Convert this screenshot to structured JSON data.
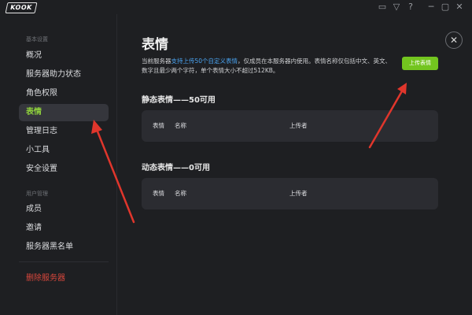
{
  "app": {
    "logo_text": "KOOK"
  },
  "window_controls": [
    "▭",
    "▽",
    "?",
    "─",
    "▢",
    "✕"
  ],
  "sidebar": {
    "section1": "基本设置",
    "items1": [
      "概况",
      "服务器助力状态",
      "角色权限",
      "表情",
      "管理日志",
      "小工具",
      "安全设置"
    ],
    "section2": "用户管理",
    "items2": [
      "成员",
      "邀请",
      "服务器黑名单"
    ],
    "danger_item": "删除服务器"
  },
  "main": {
    "title": "表情",
    "desc_pre": "当前服务器",
    "desc_link": "支持上传50个自定义表情",
    "desc_post": "，仅成员在本服务器内使用。表情名称仅包括中文、英文、数字且最少两个字符，单个表情大小不超过512KB。",
    "upload_button": "上传表情",
    "close_label": "✕",
    "static_heading": "静态表情——50可用",
    "dynamic_heading": "动态表情——0可用",
    "table_headers": [
      "表情",
      "名称",
      "上传者"
    ]
  },
  "colors": {
    "accent": "#73c51f",
    "active_text": "#8fd13c",
    "link": "#4aa3f0",
    "danger": "#d8473c",
    "annotation_arrow": "#e0362c"
  }
}
